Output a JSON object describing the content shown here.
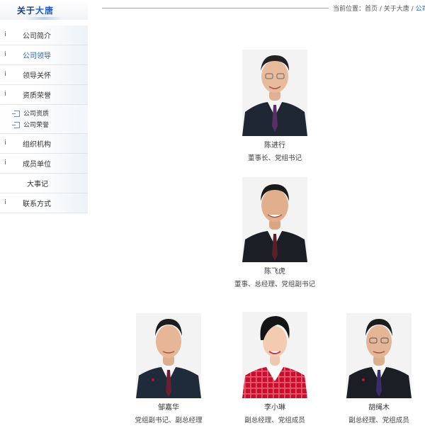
{
  "header": {
    "section_prefix": "关于",
    "section_highlight": "大唐",
    "breadcrumb_label": "当前位置：",
    "breadcrumb_home": "首页",
    "breadcrumb_sep1": " / ",
    "breadcrumb_about": "关于大唐",
    "breadcrumb_sep2": " / ",
    "breadcrumb_current": "公司"
  },
  "sidebar": {
    "items": [
      {
        "label": "公司简介"
      },
      {
        "label": "公司领导"
      },
      {
        "label": "领导关怀"
      },
      {
        "label": "资质荣誉"
      },
      {
        "label": "组织机构"
      },
      {
        "label": "成员单位"
      },
      {
        "label": "大事记"
      },
      {
        "label": "联系方式"
      }
    ],
    "subitems": [
      {
        "label": "公司资质"
      },
      {
        "label": "公司荣誉"
      }
    ]
  },
  "leaders": [
    {
      "name": "陈进行",
      "title": "董事长、党组书记"
    },
    {
      "name": "陈飞虎",
      "title": "董事、总经理、党组副书记"
    },
    {
      "name": "邹嘉华",
      "title": "党组副书记、副总经理"
    },
    {
      "name": "李小琳",
      "title": "副总经理、党组成员"
    },
    {
      "name": "胡绳木",
      "title": "副总经理、党组成员"
    }
  ],
  "colors": {
    "accent": "#1f5fc4",
    "nav_text": "#333333",
    "jacket": "#1e2733"
  }
}
